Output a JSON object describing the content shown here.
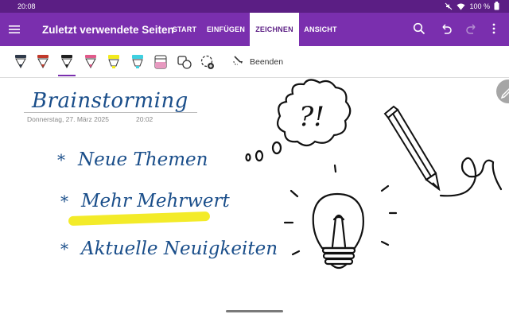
{
  "status_bar": {
    "time": "20:08",
    "battery": "100 %",
    "icons": [
      "mute-icon",
      "wifi-icon",
      "battery-icon"
    ]
  },
  "app_bar": {
    "title": "Zuletzt verwendete Seiten",
    "tabs": [
      {
        "label": "START",
        "active": false
      },
      {
        "label": "EINFÜGEN",
        "active": false
      },
      {
        "label": "ZEICHNEN",
        "active": true
      },
      {
        "label": "ANSICHT",
        "active": false
      }
    ],
    "icons": [
      "menu-icon",
      "search-icon",
      "undo-icon",
      "redo-icon",
      "more-icon"
    ]
  },
  "ribbon": {
    "tools": [
      {
        "name": "pen-dark-icon",
        "color": "#2f3a4a"
      },
      {
        "name": "pen-red-icon",
        "color": "#c0392b"
      },
      {
        "name": "pen-black-icon",
        "color": "#1f1f1f",
        "selected": true
      },
      {
        "name": "pen-pink-icon",
        "color": "#e05a8a"
      },
      {
        "name": "highlighter-yellow-icon",
        "color": "#f2ea1e"
      },
      {
        "name": "highlighter-cyan-icon",
        "color": "#3fd0e0"
      },
      {
        "name": "highlighter-pink-icon",
        "color": "#e79ac0"
      },
      {
        "name": "shapes-icon"
      },
      {
        "name": "add-pen-icon"
      }
    ],
    "finish_label": "Beenden"
  },
  "page": {
    "title": "Brainstorming",
    "date": "Donnerstag, 27. März 2025",
    "time": "20:02",
    "items": [
      {
        "bullet": "*",
        "text": "Neue Themen"
      },
      {
        "bullet": "*",
        "text": "Mehr Mehrwert",
        "highlighted": true
      },
      {
        "bullet": "*",
        "text": "Aktuelle Neuigkeiten"
      }
    ],
    "drawing_text": "?!"
  },
  "colors": {
    "app_purple": "#7a2fae",
    "status_purple": "#5b1e84",
    "ink_blue": "#1a4e8a",
    "highlight_yellow": "#f2ea1e"
  }
}
